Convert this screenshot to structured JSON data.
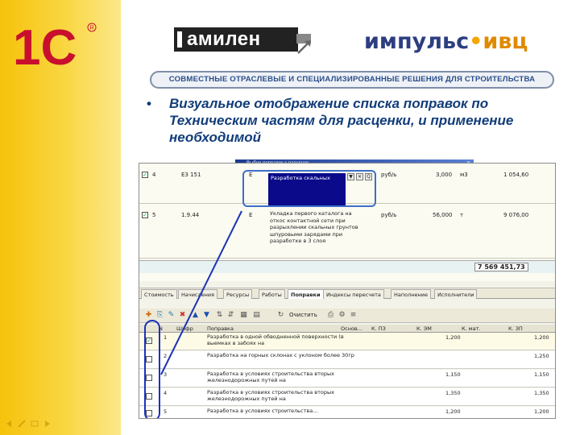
{
  "slide": {
    "banner": "СОВМЕСТНЫЕ ОТРАСЛЕВЫЕ И СПЕЦИАЛИЗИРОВАННЫЕ РЕШЕНИЯ ДЛЯ СТРОИТЕЛЬСТВА",
    "bullet": "•",
    "bullet_text": "Визуальное отображение списка поправок по Техническим частям для  расценки, и применение необходимой",
    "logo_1c": "1С",
    "logo_amilen": "амилен",
    "logo_impuls": "импульс",
    "logo_impuls_dot": "•",
    "logo_ivc": "ивц",
    "colors": {
      "band": "#f6c20b",
      "text": "#123d7a",
      "banner_border": "#7f8ea8",
      "highlight": "#1c33b8"
    }
  },
  "app": {
    "popup_title": "Выбор поправок к расценке",
    "rows": [
      {
        "num": "4",
        "code": "Е3 151",
        "e": "Е",
        "desc": "Разработка скальных",
        "unit": "руб/ь",
        "qty": "3,000",
        "unit2": "м3",
        "sum": "1 054,60"
      },
      {
        "num": "5",
        "code": "1.9.44",
        "e": "Е",
        "desc": "Укладка первого ... для основ .. в 3 слоя",
        "unit": "руб/ь",
        "qty": "56,000",
        "unit2": "т",
        "sum": "9 076,00"
      }
    ],
    "row5_lines": [
      "Укладка первого каталога на",
      "откос контактной сети при",
      "разрыхлении скальных грунтов",
      "шпуровыми зарядами при",
      "разработке в 3 слоя"
    ],
    "total": "7 569 451,73",
    "tabs": [
      "Стоимость",
      "Начисления",
      "Ресурсы",
      "Работы",
      "Поправки",
      "Индексы пересчета",
      "Наполнение",
      "Исполнители"
    ],
    "toolbar_clear": "Очистить",
    "columns": [
      "N",
      "Шифр",
      "Поправка",
      "Основ...",
      "К. ПЗ",
      "К. ЭМ",
      "К. мат.",
      "К. ЗП"
    ],
    "corrections": [
      {
        "checked": true,
        "num": "1",
        "text": "Разработка в одной обводненной поверхности (в выемках в забоях на",
        "k_em": "1,200",
        "k_zp": "1,200"
      },
      {
        "checked": false,
        "num": "2",
        "text": "Разработка на горных склонах с уклоном более 30гр",
        "k_em": "",
        "k_zp": "1,250"
      },
      {
        "checked": false,
        "num": "3",
        "text": "Разработка в условиях строительства вторых железнодорожных путей на",
        "k_em": "1,150",
        "k_zp": "1,150"
      },
      {
        "checked": false,
        "num": "4",
        "text": "Разработка в условиях строительства вторых железнодорожных путей на",
        "k_em": "1,350",
        "k_zp": "1,350"
      },
      {
        "checked": false,
        "num": "5",
        "text": "Разработка в условиях строительства...",
        "k_em": "1,200",
        "k_zp": "1,200"
      }
    ]
  }
}
